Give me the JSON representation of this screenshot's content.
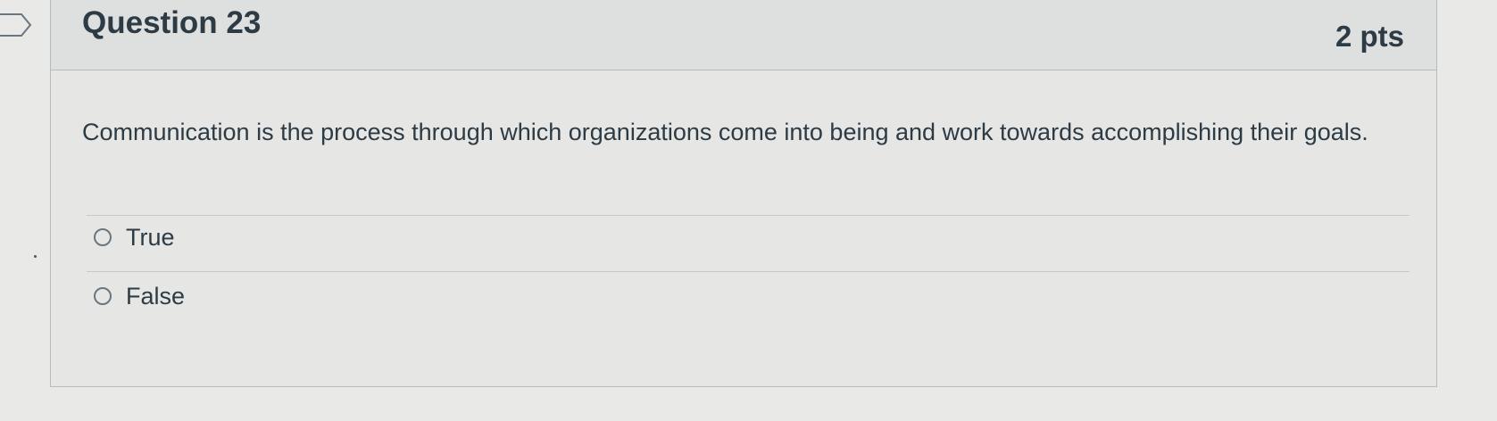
{
  "question": {
    "title": "Question 23",
    "points": "2 pts",
    "text": "Communication is the process through which organizations come into being and work towards accomplishing their goals.",
    "answers": [
      {
        "label": "True",
        "selected": false
      },
      {
        "label": "False",
        "selected": false
      }
    ]
  },
  "icons": {
    "flag": "bookmark-flag-icon",
    "radio": "radio-button-icon"
  },
  "colors": {
    "text": "#2d3b45",
    "header_bg": "#dedfdf",
    "card_bg": "#e6e6e5",
    "border": "#b8bbbc"
  }
}
